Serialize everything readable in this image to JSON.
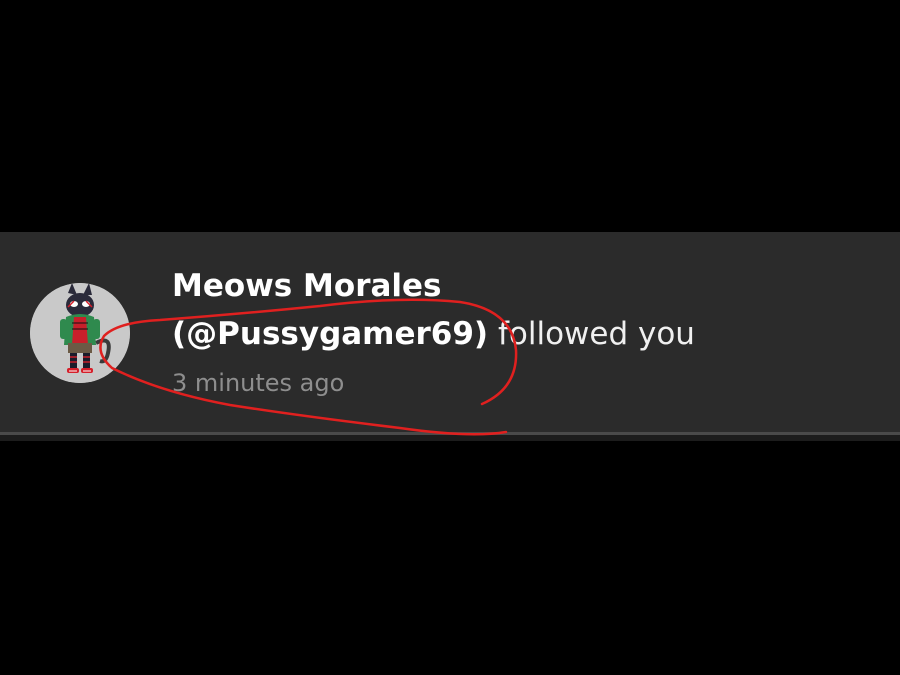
{
  "notification": {
    "display_name": "Meows Morales",
    "handle": "(@Pussygamer69)",
    "action_text": " followed you",
    "timestamp": "3 minutes ago"
  },
  "avatar": {
    "icon": "cat-character-avatar-icon"
  },
  "colors": {
    "background": "#000000",
    "card": "#2b2b2b",
    "name_text": "#ffffff",
    "timestamp_text": "#8e8e8e",
    "annotation": "#e0201f"
  }
}
